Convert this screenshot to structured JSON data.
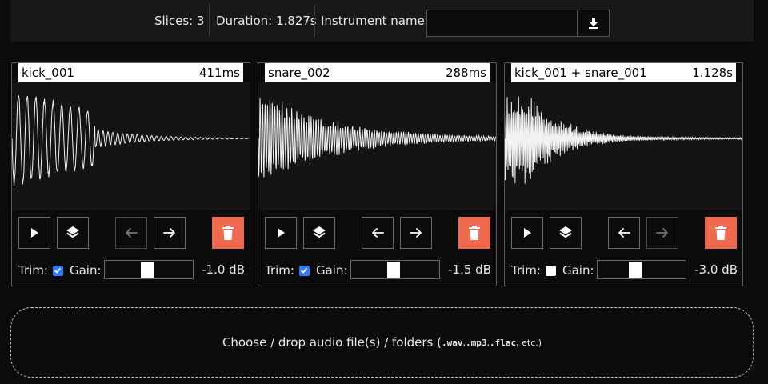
{
  "topbar": {
    "slices": "Slices: 3",
    "duration": "Duration: 1.827s",
    "instrument_label": "Instrument name:",
    "instrument_value": ""
  },
  "cards": [
    {
      "name": "kick_001",
      "length": "411ms",
      "trim_checked": true,
      "trim_label": "Trim:",
      "gain_label": "Gain:",
      "gain_db": "-1.0 dB",
      "gain_level": 0.47,
      "left_enabled": false,
      "right_enabled": true
    },
    {
      "name": "snare_002",
      "length": "288ms",
      "trim_checked": true,
      "trim_label": "Trim:",
      "gain_label": "Gain:",
      "gain_db": "-1.5 dB",
      "gain_level": 0.47,
      "left_enabled": true,
      "right_enabled": true
    },
    {
      "name": "kick_001 + snare_001",
      "length": "1.128s",
      "trim_checked": false,
      "trim_label": "Trim:",
      "gain_label": "Gain:",
      "gain_db": "-3.0 dB",
      "gain_level": 0.42,
      "left_enabled": true,
      "right_enabled": false
    }
  ],
  "dropzone": {
    "text_a": "Choose / drop audio file(s) / folders (",
    "ext1": ".wav",
    "sep1": ", ",
    "ext2": ".mp3",
    "sep2": ", ",
    "ext3": ".flac",
    "text_b": ", etc.)"
  },
  "icons": {
    "download": "download-icon",
    "play": "play-icon",
    "layers": "layers-icon",
    "left": "arrow-left-icon",
    "right": "arrow-right-icon",
    "delete": "trash-icon"
  },
  "colors": {
    "accent_delete": "#ef6a4f",
    "checkbox": "#2f7cf6",
    "background": "#0b0b0b"
  }
}
